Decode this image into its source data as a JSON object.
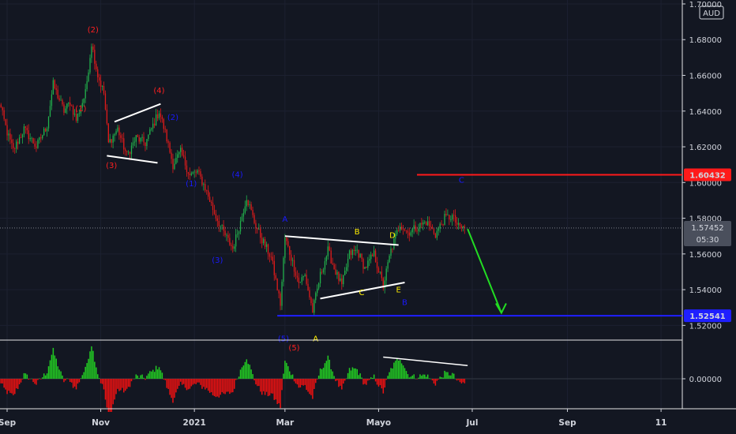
{
  "chart_data": {
    "type": "candlestick",
    "title": "",
    "currency_badge": "AUD",
    "y_ticks": [
      1.52,
      1.54,
      1.56,
      1.58,
      1.6,
      1.62,
      1.64,
      1.66,
      1.68,
      1.7
    ],
    "y_tick_labels": [
      "1.52000",
      "1.54000",
      "1.56000",
      "1.58000",
      "1.60000",
      "1.62000",
      "1.64000",
      "1.66000",
      "1.68000",
      "1.70000"
    ],
    "ylim": [
      1.5122,
      1.7022
    ],
    "x_ticks": [
      {
        "label": "Sep",
        "date": "2020-09-01"
      },
      {
        "label": "Nov",
        "date": "2020-11-01"
      },
      {
        "label": "2021",
        "date": "2021-01-01"
      },
      {
        "label": "Mar",
        "date": "2021-03-01"
      },
      {
        "label": "Mayo",
        "date": "2021-05-01"
      },
      {
        "label": "Jul",
        "date": "2021-07-01"
      },
      {
        "label": "Sep",
        "date": "2021-09-01"
      },
      {
        "label": "11",
        "date": "2021-11-01"
      }
    ],
    "price_path": [
      [
        "2020-08-26",
        1.648
      ],
      [
        "2020-09-01",
        1.628
      ],
      [
        "2020-09-05",
        1.618
      ],
      [
        "2020-09-12",
        1.63
      ],
      [
        "2020-09-20",
        1.62
      ],
      [
        "2020-09-27",
        1.632
      ],
      [
        "2020-10-01",
        1.655
      ],
      [
        "2020-10-08",
        1.64
      ],
      [
        "2020-10-12",
        1.645
      ],
      [
        "2020-10-16",
        1.635
      ],
      [
        "2020-10-22",
        1.65
      ],
      [
        "2020-10-26",
        1.678
      ],
      [
        "2020-10-30",
        1.66
      ],
      [
        "2020-11-03",
        1.65
      ],
      [
        "2020-11-06",
        1.622
      ],
      [
        "2020-11-12",
        1.63
      ],
      [
        "2020-11-18",
        1.615
      ],
      [
        "2020-11-24",
        1.625
      ],
      [
        "2020-11-30",
        1.622
      ],
      [
        "2020-12-04",
        1.63
      ],
      [
        "2020-12-09",
        1.64
      ],
      [
        "2020-12-13",
        1.628
      ],
      [
        "2020-12-18",
        1.61
      ],
      [
        "2020-12-23",
        1.617
      ],
      [
        "2020-12-29",
        1.604
      ],
      [
        "2021-01-03",
        1.606
      ],
      [
        "2021-01-08",
        1.597
      ],
      [
        "2021-01-14",
        1.583
      ],
      [
        "2021-01-20",
        1.572
      ],
      [
        "2021-01-26",
        1.563
      ],
      [
        "2021-01-31",
        1.578
      ],
      [
        "2021-02-04",
        1.592
      ],
      [
        "2021-02-09",
        1.578
      ],
      [
        "2021-02-14",
        1.568
      ],
      [
        "2021-02-20",
        1.558
      ],
      [
        "2021-02-26",
        1.532
      ],
      [
        "2021-03-01",
        1.569
      ],
      [
        "2021-03-05",
        1.558
      ],
      [
        "2021-03-10",
        1.544
      ],
      [
        "2021-03-14",
        1.548
      ],
      [
        "2021-03-19",
        1.528
      ],
      [
        "2021-03-24",
        1.548
      ],
      [
        "2021-03-29",
        1.562
      ],
      [
        "2021-04-02",
        1.552
      ],
      [
        "2021-04-07",
        1.542
      ],
      [
        "2021-04-12",
        1.56
      ],
      [
        "2021-04-17",
        1.562
      ],
      [
        "2021-04-22",
        1.552
      ],
      [
        "2021-04-28",
        1.56
      ],
      [
        "2021-05-04",
        1.542
      ],
      [
        "2021-05-09",
        1.562
      ],
      [
        "2021-05-15",
        1.577
      ],
      [
        "2021-05-20",
        1.572
      ],
      [
        "2021-05-26",
        1.575
      ],
      [
        "2021-06-01",
        1.578
      ],
      [
        "2021-06-07",
        1.571
      ],
      [
        "2021-06-13",
        1.58
      ],
      [
        "2021-06-18",
        1.581
      ],
      [
        "2021-06-22",
        1.575
      ],
      [
        "2021-06-26",
        1.5745
      ]
    ],
    "horizontal_levels": [
      {
        "value": 1.60432,
        "label": "1.60432",
        "color": "#ff1a1a",
        "from_date": "2021-05-26"
      },
      {
        "value": 1.52541,
        "label": "1.52541",
        "color": "#1f1fff",
        "from_date": "2021-02-24"
      }
    ],
    "last_price": {
      "label": "1.57452",
      "countdown": "05:30",
      "value": 1.57452
    },
    "trendlines": [
      {
        "points": [
          [
            "2020-11-10",
            1.634
          ],
          [
            "2020-12-10",
            1.644
          ]
        ],
        "color": "#ffffff"
      },
      {
        "points": [
          [
            "2020-11-05",
            1.615
          ],
          [
            "2020-12-08",
            1.611
          ]
        ],
        "color": "#ffffff"
      },
      {
        "points": [
          [
            "2021-03-01",
            1.57
          ],
          [
            "2021-05-14",
            1.565
          ]
        ],
        "color": "#ffffff"
      },
      {
        "points": [
          [
            "2021-03-24",
            1.535
          ],
          [
            "2021-05-18",
            1.544
          ]
        ],
        "color": "#ffffff"
      }
    ],
    "arrow": {
      "from": [
        [
          "2021-06-28",
          1.574
        ],
        [
          "2021-07-20",
          1.527
        ]
      ],
      "color": "#22dd22"
    },
    "wave_labels": [
      {
        "text": "(2)",
        "date": "2020-10-27",
        "price": 1.684,
        "color": "#ff2020"
      },
      {
        "text": "(1)",
        "date": "2020-10-19",
        "price": 1.64,
        "color": "#ff2020"
      },
      {
        "text": "(3)",
        "date": "2020-11-08",
        "price": 1.608,
        "color": "#ff2020"
      },
      {
        "text": "(4)",
        "date": "2020-12-09",
        "price": 1.65,
        "color": "#ff2020"
      },
      {
        "text": "(5)",
        "date": "2021-03-07",
        "price": 1.506,
        "color": "#ff2020"
      },
      {
        "text": "(2)",
        "date": "2020-12-18",
        "price": 1.635,
        "color": "#1a1aff"
      },
      {
        "text": "(1)",
        "date": "2020-12-30",
        "price": 1.598,
        "color": "#1a1aff"
      },
      {
        "text": "(4)",
        "date": "2021-01-29",
        "price": 1.603,
        "color": "#1a1aff"
      },
      {
        "text": "(3)",
        "date": "2021-01-16",
        "price": 1.555,
        "color": "#1a1aff"
      },
      {
        "text": "(5)",
        "date": "2021-02-28",
        "price": 1.511,
        "color": "#1a1aff"
      },
      {
        "text": "A",
        "date": "2021-03-01",
        "price": 1.578,
        "color": "#1a1aff"
      },
      {
        "text": "B",
        "date": "2021-05-18",
        "price": 1.5315,
        "color": "#1a1aff"
      },
      {
        "text": "C",
        "date": "2021-06-24",
        "price": 1.6,
        "color": "#1a1aff"
      },
      {
        "text": "A",
        "date": "2021-03-21",
        "price": 1.511,
        "color": "#ffee00"
      },
      {
        "text": "B",
        "date": "2021-04-17",
        "price": 1.571,
        "color": "#ffee00"
      },
      {
        "text": "C",
        "date": "2021-04-20",
        "price": 1.537,
        "color": "#ffee00"
      },
      {
        "text": "D",
        "date": "2021-05-10",
        "price": 1.569,
        "color": "#ffee00"
      },
      {
        "text": "E",
        "date": "2021-05-14",
        "price": 1.5385,
        "color": "#ffee00"
      }
    ]
  },
  "oscillator": {
    "y_ticks": [
      0.0
    ],
    "y_tick_labels": [
      "0.00000"
    ],
    "trendline": {
      "points": [
        [
          "2021-05-04",
          0.36
        ],
        [
          "2021-06-28",
          0.22
        ]
      ],
      "color": "#ffffff"
    },
    "colors": {
      "positive": "#22cc22",
      "negative": "#ee1111"
    }
  }
}
